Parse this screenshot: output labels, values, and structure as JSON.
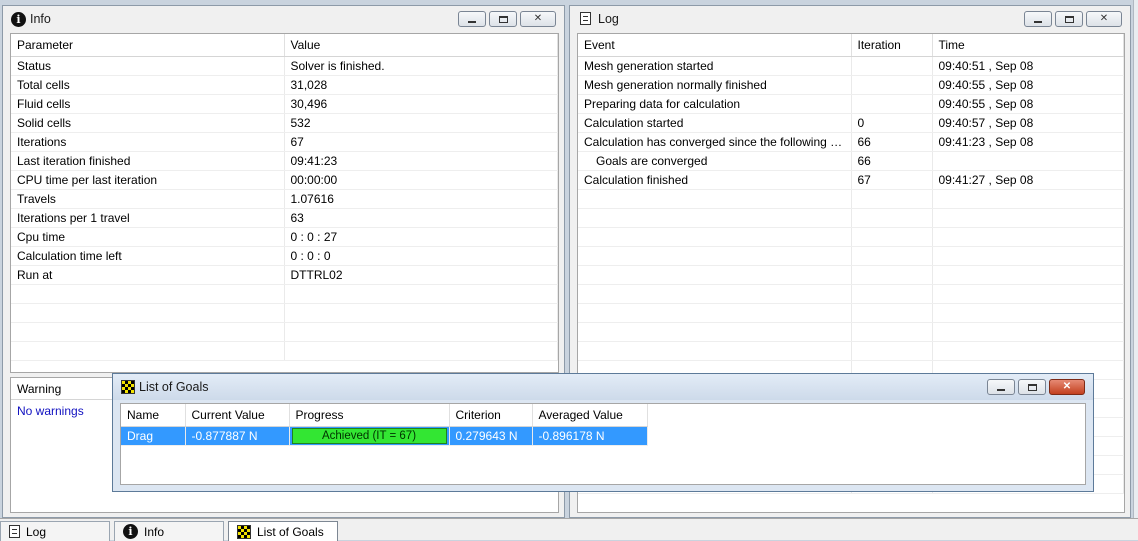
{
  "info": {
    "title": "Info",
    "columns": [
      "Parameter",
      "Value"
    ],
    "rows": [
      [
        "Status",
        "Solver is finished."
      ],
      [
        "Total cells",
        "31,028"
      ],
      [
        "Fluid cells",
        "30,496"
      ],
      [
        "Solid cells",
        "532"
      ],
      [
        "Iterations",
        "67"
      ],
      [
        "Last iteration finished",
        "09:41:23"
      ],
      [
        "CPU time per last iteration",
        "00:00:00"
      ],
      [
        "Travels",
        "1.07616"
      ],
      [
        "Iterations per 1 travel",
        "63"
      ],
      [
        "Cpu time",
        "0 : 0 : 27"
      ],
      [
        "Calculation time left",
        "0 : 0 : 0"
      ],
      [
        "Run at",
        "DTTRL02"
      ]
    ],
    "warning_header": "Warning",
    "warning_text": "No warnings"
  },
  "log": {
    "title": "Log",
    "columns": [
      "Event",
      "Iteration",
      "Time"
    ],
    "rows": [
      {
        "event": "Mesh generation started",
        "iteration": "",
        "time": "09:40:51 , Sep 08",
        "indent": false
      },
      {
        "event": "Mesh generation normally finished",
        "iteration": "",
        "time": "09:40:55 , Sep 08",
        "indent": false
      },
      {
        "event": "Preparing data for calculation",
        "iteration": "",
        "time": "09:40:55 , Sep 08",
        "indent": false
      },
      {
        "event": "Calculation started",
        "iteration": "0",
        "time": "09:40:57 , Sep 08",
        "indent": false
      },
      {
        "event": "Calculation has converged since the following cr...",
        "iteration": "66",
        "time": "09:41:23 , Sep 08",
        "indent": false
      },
      {
        "event": "Goals are converged",
        "iteration": "66",
        "time": "",
        "indent": true
      },
      {
        "event": "Calculation finished",
        "iteration": "67",
        "time": "09:41:27 , Sep 08",
        "indent": false
      }
    ]
  },
  "goals": {
    "title": "List of Goals",
    "columns": [
      "Name",
      "Current Value",
      "Progress",
      "Criterion",
      "Averaged Value"
    ],
    "rows": [
      {
        "name": "Drag",
        "current": "-0.877887 N",
        "progress": "Achieved (IT = 67)",
        "progress_fraction": 1.0,
        "criterion": "0.279643 N",
        "averaged": "-0.896178 N"
      }
    ]
  },
  "taskbar": {
    "tabs": [
      {
        "label": "Log",
        "icon": "document-icon",
        "active": false
      },
      {
        "label": "Info",
        "icon": "info-icon",
        "active": false
      },
      {
        "label": "List of Goals",
        "icon": "goals-flag-icon",
        "active": true
      }
    ]
  },
  "colors": {
    "selection": "#3399ff",
    "progress_fill": "#33e633",
    "warning_text": "#1010c0"
  }
}
